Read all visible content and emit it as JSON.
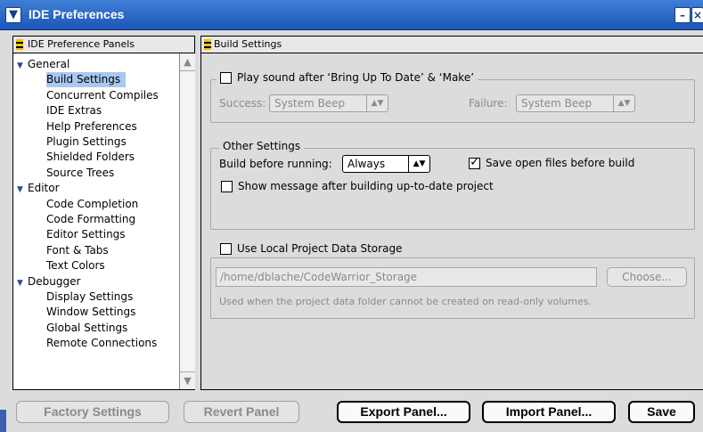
{
  "window": {
    "title": "IDE Preferences"
  },
  "left_panel": {
    "header": "IDE Preference Panels",
    "items": [
      {
        "label": "General",
        "type": "group"
      },
      {
        "label": "Build Settings",
        "type": "child",
        "selected": true
      },
      {
        "label": "Concurrent Compiles",
        "type": "child"
      },
      {
        "label": "IDE Extras",
        "type": "child"
      },
      {
        "label": "Help Preferences",
        "type": "child"
      },
      {
        "label": "Plugin Settings",
        "type": "child"
      },
      {
        "label": "Shielded Folders",
        "type": "child"
      },
      {
        "label": "Source Trees",
        "type": "child"
      },
      {
        "label": "Editor",
        "type": "group"
      },
      {
        "label": "Code Completion",
        "type": "child"
      },
      {
        "label": "Code Formatting",
        "type": "child"
      },
      {
        "label": "Editor Settings",
        "type": "child"
      },
      {
        "label": "Font & Tabs",
        "type": "child"
      },
      {
        "label": "Text Colors",
        "type": "child"
      },
      {
        "label": "Debugger",
        "type": "group"
      },
      {
        "label": "Display Settings",
        "type": "child"
      },
      {
        "label": "Window Settings",
        "type": "child"
      },
      {
        "label": "Global Settings",
        "type": "child"
      },
      {
        "label": "Remote Connections",
        "type": "child"
      }
    ]
  },
  "right_panel": {
    "header": "Build Settings",
    "play_sound": {
      "label": "Play sound after ‘Bring Up To Date’ & ‘Make’",
      "checked": false,
      "success_label": "Success:",
      "success_value": "System Beep",
      "failure_label": "Failure:",
      "failure_value": "System Beep"
    },
    "other_settings": {
      "title": "Other Settings",
      "build_before_label": "Build before running:",
      "build_before_value": "Always",
      "save_open_files_label": "Save open files before build",
      "save_open_files_checked": true,
      "show_message_label": "Show message after building up-to-date project",
      "show_message_checked": false
    },
    "local_storage": {
      "label": "Use Local Project Data Storage",
      "checked": false,
      "path": "/home/dblache/CodeWarrior_Storage",
      "choose_label": "Choose...",
      "note": "Used when the project data folder cannot be created on read-only volumes."
    }
  },
  "buttons": {
    "factory": "Factory Settings",
    "revert": "Revert Panel",
    "export": "Export Panel...",
    "import": "Import Panel...",
    "save": "Save"
  }
}
